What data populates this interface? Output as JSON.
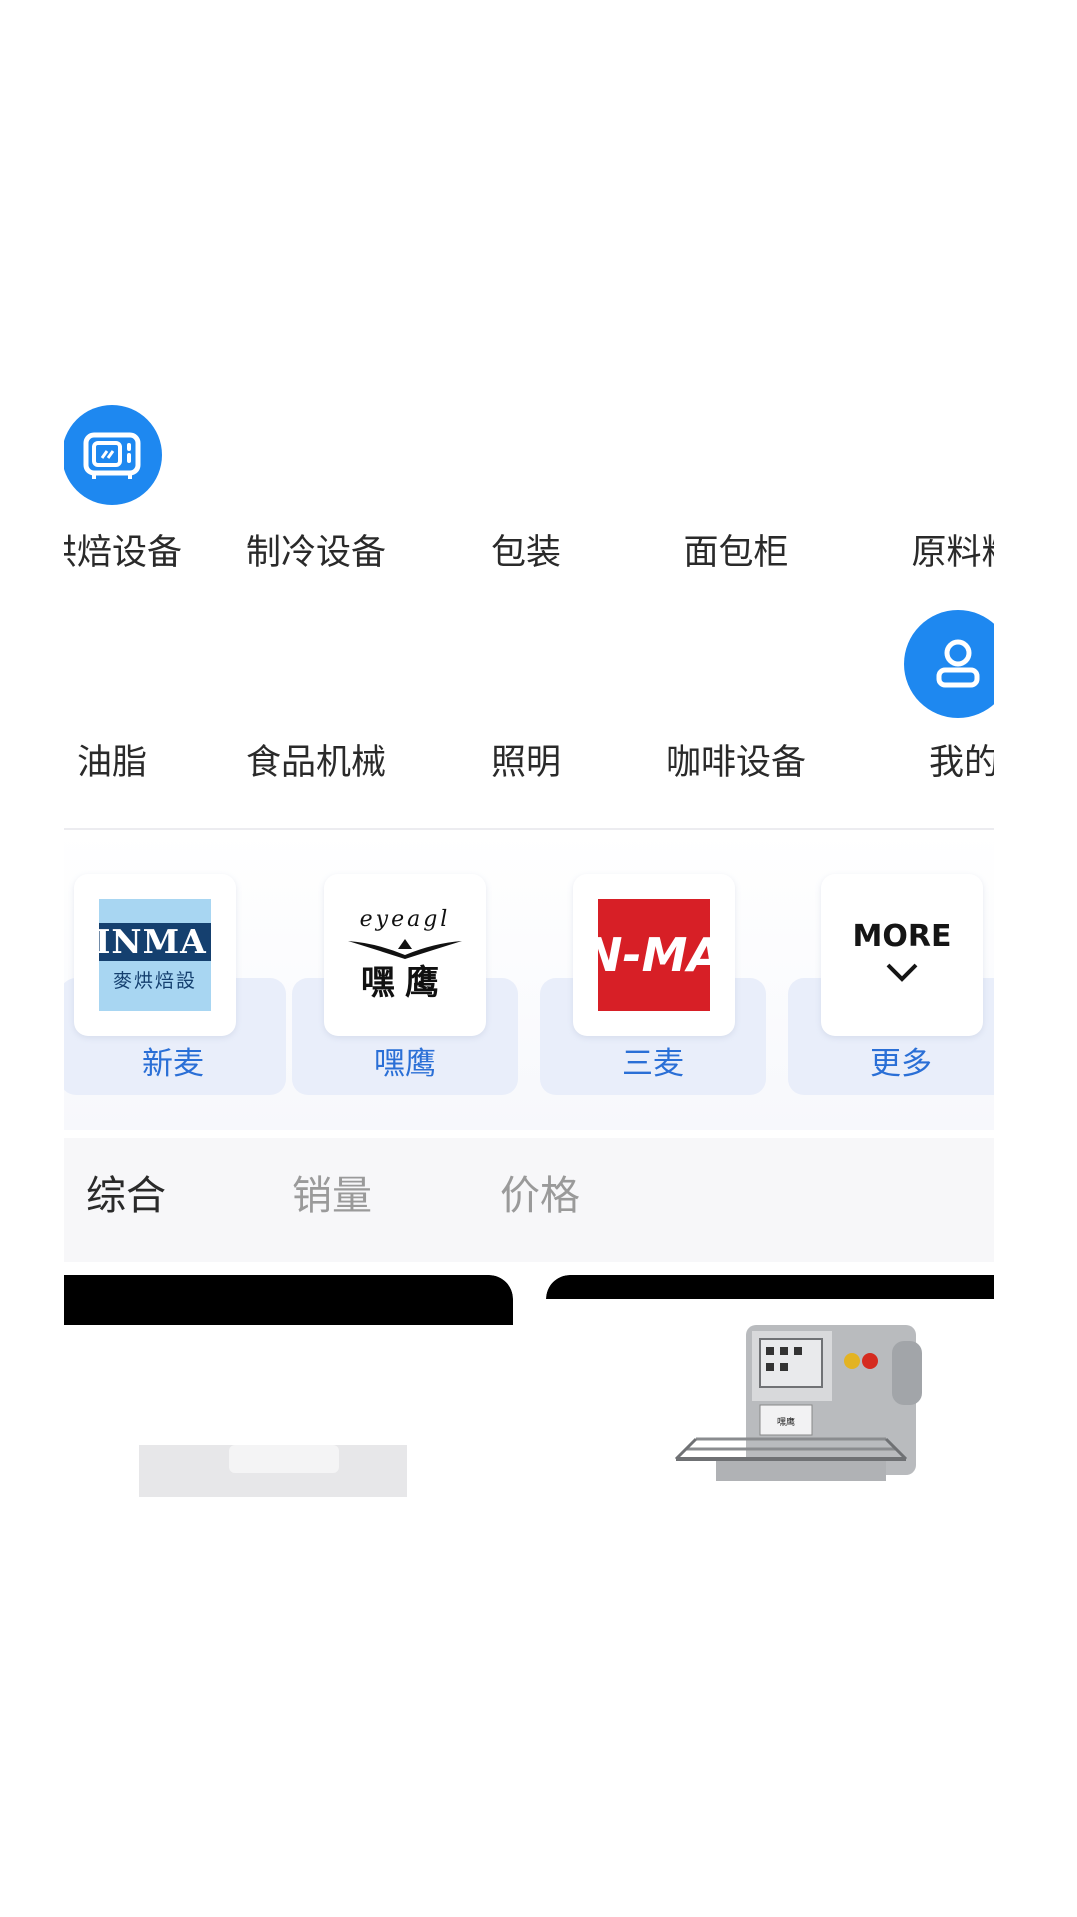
{
  "categories_row1": [
    {
      "label": "烘焙设备",
      "icon": "oven-icon"
    },
    {
      "label": "制冷设备"
    },
    {
      "label": "包装"
    },
    {
      "label": "面包柜"
    },
    {
      "label": "原料料"
    }
  ],
  "categories_row2": [
    {
      "label": "油脂"
    },
    {
      "label": "食品机械"
    },
    {
      "label": "照明"
    },
    {
      "label": "咖啡设备"
    },
    {
      "label": "我的",
      "icon": "user-icon"
    }
  ],
  "brands": [
    {
      "name": "新麦",
      "logo_line1": "INMA",
      "logo_line2": "麥烘焙設"
    },
    {
      "name": "嘿鹰",
      "logo_line1": "eyeagl",
      "logo_line2": "嘿鹰"
    },
    {
      "name": "三麦",
      "logo_line1": "N-MA"
    },
    {
      "name": "更多",
      "logo_line1": "MORE"
    }
  ],
  "sort_tabs": [
    {
      "label": "综合",
      "active": true
    },
    {
      "label": "销量",
      "active": false
    },
    {
      "label": "价格",
      "active": false
    }
  ],
  "colors": {
    "accent": "#1e88f0",
    "brand_text": "#2a6fd6",
    "brand_card": "#e9eefa",
    "sanmai_red": "#d71f26",
    "xinmai_bg": "#a8d6f2"
  }
}
